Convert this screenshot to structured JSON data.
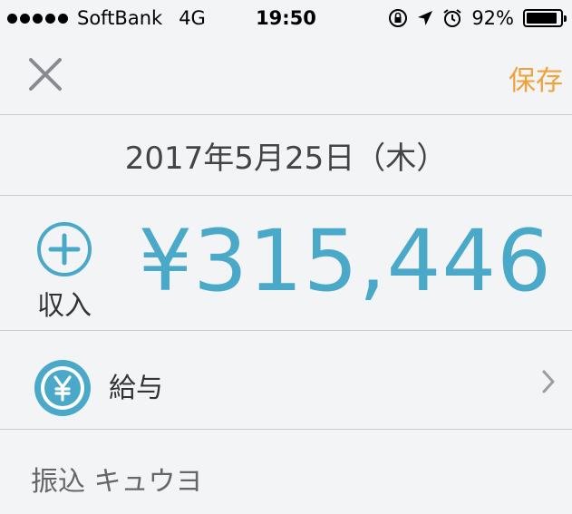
{
  "status_bar": {
    "carrier": "SoftBank",
    "network": "4G",
    "time": "19:50",
    "battery": "92%",
    "battery_level": 0.92,
    "icons": [
      "orientation-lock-icon",
      "location-arrow-icon",
      "alarm-icon"
    ]
  },
  "nav": {
    "close_icon": "close-icon",
    "save_label": "保存"
  },
  "date": {
    "label": "2017年5月25日（木）"
  },
  "transaction": {
    "type_icon": "plus-circle-icon",
    "type_label": "収入",
    "amount": "¥315,446"
  },
  "category": {
    "icon": "yen-icon",
    "label": "給与"
  },
  "memo": {
    "value": "振込 キュウヨ"
  },
  "colors": {
    "accent_blue": "#4aa8c8",
    "save_orange": "#f0a23a",
    "background": "#f2f4f6",
    "divider": "#c9cbce"
  }
}
